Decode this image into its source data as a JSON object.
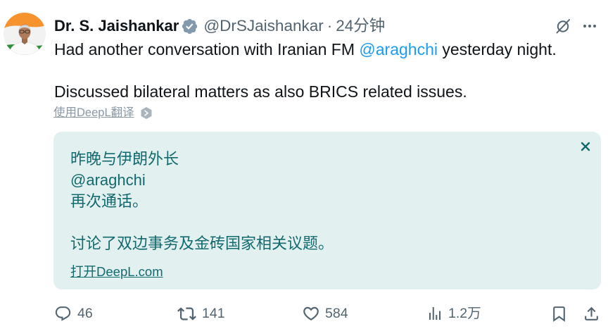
{
  "colors": {
    "text": "#0f1419",
    "secondary": "#536471",
    "link": "#1d9bf0",
    "verified": "#829aab",
    "translation_bg": "#e3f0f0",
    "translation_text": "#126a6e",
    "muted": "#8b98a5"
  },
  "author": {
    "name": "Dr. S. Jaishankar",
    "handle": "@DrSJaishankar",
    "separator": "·",
    "time": "24分钟",
    "avatar_icon": "avatar-image",
    "badge_icon": "verified-badge-icon"
  },
  "toolbar": {
    "grok_icon": "grok-icon",
    "more_icon": "more-icon"
  },
  "tweet": {
    "text_before_mention": "Had another conversation with Iranian FM ",
    "mention": "@araghchi",
    "text_after_mention": " yesterday night.",
    "second_paragraph": "Discussed bilateral matters as also BRICS related issues."
  },
  "translate_prompt": {
    "label": "使用DeepL翻译",
    "icon": "deepl-icon"
  },
  "translation": {
    "lines": [
      "昨晚与伊朗外长",
      "@araghchi",
      "再次通话。",
      "讨论了双边事务及金砖国家相关议题。"
    ],
    "open_link": "打开DeepL.com",
    "close_icon": "close-icon"
  },
  "actions": {
    "reply": {
      "icon": "reply-icon",
      "count": "46"
    },
    "retweet": {
      "icon": "retweet-icon",
      "count": "141"
    },
    "like": {
      "icon": "heart-icon",
      "count": "584"
    },
    "views": {
      "icon": "views-icon",
      "count": "1.2万"
    },
    "bookmark": {
      "icon": "bookmark-icon"
    },
    "share": {
      "icon": "share-icon"
    }
  }
}
